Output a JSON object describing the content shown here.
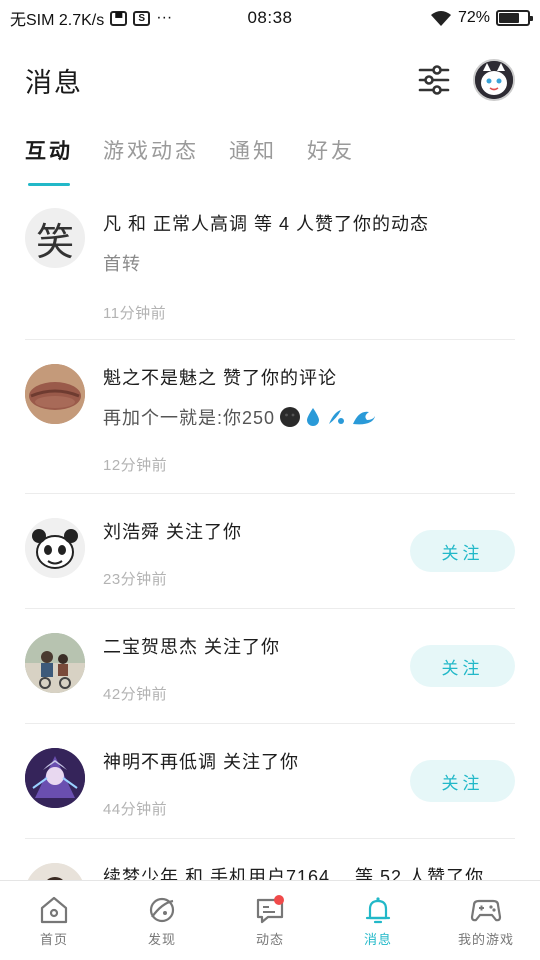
{
  "status_bar": {
    "carrier": "无SIM 2.7K/s",
    "icons": [
      "dual-sim-icon",
      "s-icon",
      "more-dots-icon"
    ],
    "more": "···",
    "time": "08:38",
    "battery_pct_text": "72%",
    "battery_level": 0.72
  },
  "header": {
    "title": "消息"
  },
  "tabs": [
    {
      "label": "互动",
      "active": true
    },
    {
      "label": "游戏动态",
      "active": false
    },
    {
      "label": "通知",
      "active": false
    },
    {
      "label": "好友",
      "active": false
    }
  ],
  "feed": [
    {
      "text": "凡 和 正常人高调 等 4 人赞了你的动态",
      "sub": "首转",
      "time": "11分钟前",
      "avatar_glyph": "笑"
    },
    {
      "text": "魁之不是魅之 赞了你的评论",
      "sub": "再加个一就是:你250",
      "time": "12分钟前"
    },
    {
      "text": "刘浩舜 关注了你",
      "time": "23分钟前",
      "button": "关注"
    },
    {
      "text": "二宝贺思杰 关注了你",
      "time": "42分钟前",
      "button": "关注"
    },
    {
      "text": "神明不再低调 关注了你",
      "time": "44分钟前",
      "button": "关注"
    },
    {
      "text": "续梦少年 和 手机用户7164… 等 52 人赞了你"
    }
  ],
  "bottom_nav": [
    {
      "label": "首页",
      "icon": "home-icon"
    },
    {
      "label": "发现",
      "icon": "planet-icon"
    },
    {
      "label": "动态",
      "icon": "chat-bubble-icon"
    },
    {
      "label": "消息",
      "icon": "bell-icon",
      "active": true
    },
    {
      "label": "我的游戏",
      "icon": "gamepad-icon"
    }
  ],
  "colors": {
    "accent": "#22b8c8",
    "follow_bg": "#e6f7f8",
    "badge": "#f04a4a"
  }
}
